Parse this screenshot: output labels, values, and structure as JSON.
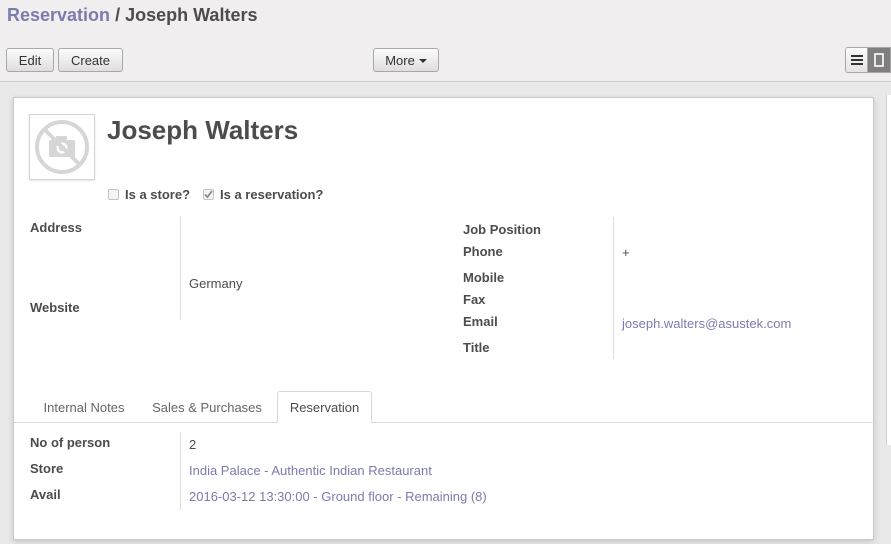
{
  "breadcrumb": {
    "parent": "Reservation",
    "separator": "/",
    "current": "Joseph Walters"
  },
  "toolbar": {
    "edit_label": "Edit",
    "create_label": "Create",
    "more_label": "More"
  },
  "view_switch": {
    "list_icon": "list-view-icon",
    "form_icon": "form-view-icon"
  },
  "record": {
    "name": "Joseph Walters",
    "avatar_icon": "no-photo-camera-icon",
    "is_store": {
      "label": "Is a store?",
      "checked": false
    },
    "is_reservation": {
      "label": "Is a reservation?",
      "checked": true
    }
  },
  "left_fields": {
    "address_label": "Address",
    "address_country": "Germany",
    "website_label": "Website"
  },
  "right_fields": {
    "job_position_label": "Job Position",
    "phone_label": "Phone",
    "phone_value": "+",
    "mobile_label": "Mobile",
    "fax_label": "Fax",
    "email_label": "Email",
    "email_value": "joseph.walters@asustek.com",
    "title_label": "Title"
  },
  "tabs": [
    {
      "label": "Internal Notes",
      "active": false
    },
    {
      "label": "Sales & Purchases",
      "active": false
    },
    {
      "label": "Reservation",
      "active": true
    }
  ],
  "reservation_tab": {
    "persons_label": "No of person",
    "persons_value": "2",
    "store_label": "Store",
    "store_value": "India Palace - Authentic Indian Restaurant",
    "avail_label": "Avail",
    "avail_value": "2016-03-12 13:30:00 - Ground floor - Remaining (8)"
  },
  "colors": {
    "link": "#7c7bad",
    "text": "#4c4c4c",
    "active_view": "#7f7f7f"
  }
}
